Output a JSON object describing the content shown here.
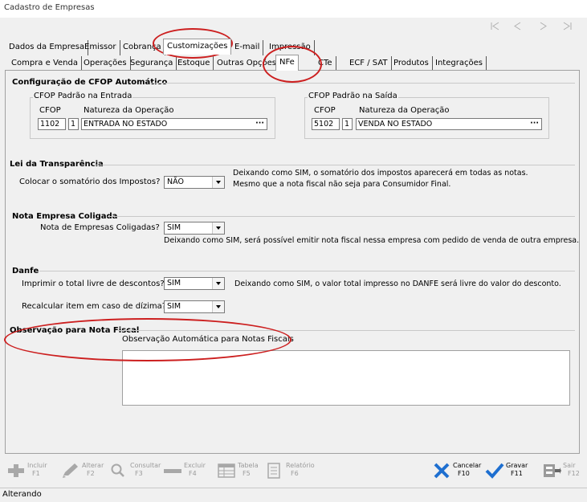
{
  "window": {
    "title": "Cadastro de Empresas"
  },
  "nav_icons": [
    "first-icon",
    "prev-icon",
    "next-icon",
    "last-icon"
  ],
  "tabs_primary": [
    "Dados da Empresa",
    "Emissor",
    "Cobrança",
    "Customizações",
    "E-mail",
    "Impressão"
  ],
  "tabs_secondary": [
    "Compra e Venda",
    "Operações",
    "Segurança",
    "Estoque",
    "Outras Opções",
    "NFe",
    "CTe",
    "ECF / SAT",
    "Produtos",
    "Integrações"
  ],
  "cfop": {
    "title": "Configuração de CFOP Automático",
    "entrada": {
      "legend": "CFOP Padrão na Entrada",
      "cfop_label": "CFOP",
      "natureza_label": "Natureza da Operação",
      "cfop_value": "1102",
      "seq": "1",
      "natureza_value": "ENTRADA NO ESTADO",
      "dots": "···"
    },
    "saida": {
      "legend": "CFOP Padrão na Saída",
      "cfop_label": "CFOP",
      "natureza_label": "Natureza da Operação",
      "cfop_value": "5102",
      "seq": "1",
      "natureza_value": "VENDA NO ESTADO",
      "dots": "···"
    }
  },
  "transparencia": {
    "title": "Lei da Transparência",
    "label": "Colocar o somatório dos Impostos?",
    "value": "NÃO",
    "note1": "Deixando como SIM, o somatório dos impostos aparecerá em todas as notas.",
    "note2": "Mesmo que a nota fiscal não seja para Consumidor Final."
  },
  "coligada": {
    "title": "Nota Empresa Coligada",
    "label": "Nota de Empresas Coligadas?",
    "value": "SIM",
    "note": "Deixando como SIM, será possível emitir nota fiscal nessa empresa com pedido de venda de outra empresa."
  },
  "danfe": {
    "title": "Danfe",
    "label1": "Imprimir o total livre de descontos?",
    "value1": "SIM",
    "note1": "Deixando como SIM, o valor total impresso no DANFE será livre do valor do desconto.",
    "label2": "Recalcular item em caso de dízima?",
    "value2": "SIM"
  },
  "observacao": {
    "title": "Observação para Nota Fiscal",
    "label": "Observação Automática para Notas Fiscais",
    "value": ""
  },
  "toolbar": {
    "incluir": {
      "label": "Incluir",
      "key": "F1"
    },
    "alterar": {
      "label": "Alterar",
      "key": "F2"
    },
    "consultar": {
      "label": "Consultar",
      "key": "F3"
    },
    "excluir": {
      "label": "Excluir",
      "key": "F4"
    },
    "tabela": {
      "label": "Tabela",
      "key": "F5"
    },
    "relatorio": {
      "label": "Relatório",
      "key": "F6"
    },
    "cancelar": {
      "label": "Cancelar",
      "key": "F10"
    },
    "gravar": {
      "label": "Gravar",
      "key": "F11"
    },
    "sair": {
      "label": "Sair",
      "key": "F12"
    }
  },
  "status": {
    "text": "Alterando"
  },
  "colors": {
    "accent_blue": "#1e6fd0",
    "annotation_red": "#cc1f1f"
  }
}
